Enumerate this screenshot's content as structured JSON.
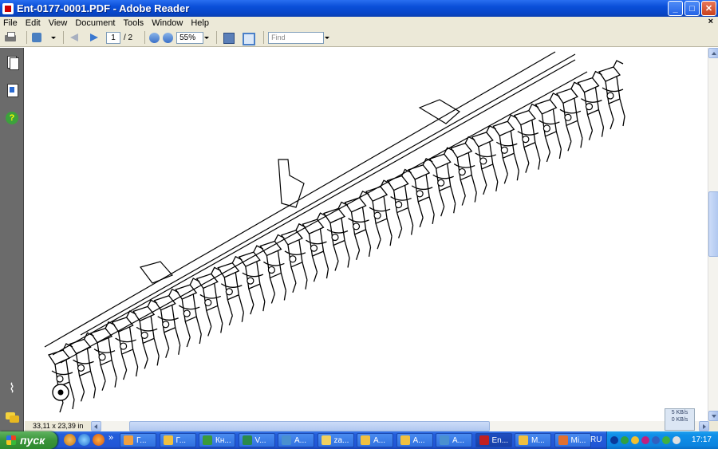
{
  "window": {
    "title": "Ent-0177-0001.PDF - Adobe Reader",
    "minimize": "_",
    "maximize": "□",
    "close": "✕"
  },
  "menu": {
    "items": [
      "File",
      "Edit",
      "View",
      "Document",
      "Tools",
      "Window",
      "Help"
    ],
    "doc_close": "×"
  },
  "toolbar": {
    "page_current": "1",
    "page_total": "/ 2",
    "zoom_value": "55%",
    "find_placeholder": "Find"
  },
  "status": {
    "page_size": "33,11 x 23,39 in"
  },
  "net_widget": {
    "line1": "5 KB/s",
    "line2": "0 KB/s"
  },
  "taskbar": {
    "start_label": "пуск",
    "chevron": "»",
    "tasks": [
      {
        "label": "Г...",
        "color": "#f0a040"
      },
      {
        "label": "Г...",
        "color": "#f0c040"
      },
      {
        "label": "Кн...",
        "color": "#3a9a3a"
      },
      {
        "label": "V...",
        "color": "#2a8a4a"
      },
      {
        "label": "А...",
        "color": "#4a90d0"
      },
      {
        "label": "za...",
        "color": "#f0d060"
      },
      {
        "label": "А...",
        "color": "#f0c040"
      },
      {
        "label": "А...",
        "color": "#f0c040"
      },
      {
        "label": "А...",
        "color": "#4a90d0"
      },
      {
        "label": "En...",
        "color": "#c02020"
      },
      {
        "label": "М...",
        "color": "#f0c040"
      },
      {
        "label": "Mi...",
        "color": "#e07030"
      }
    ],
    "language": "RU",
    "clock": "17:17"
  }
}
